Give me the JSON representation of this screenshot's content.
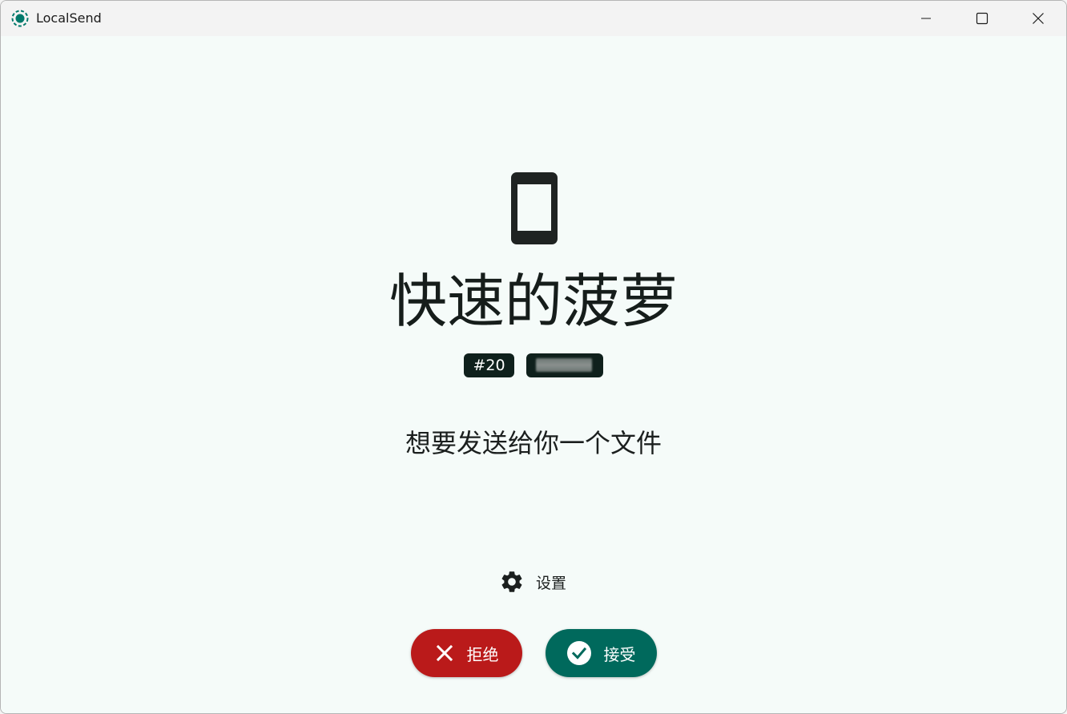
{
  "window": {
    "title": "LocalSend",
    "controls": [
      "minimize",
      "maximize",
      "close"
    ]
  },
  "device": {
    "icon": "phone-icon",
    "name": "快速的菠萝",
    "badges": {
      "port_label": "#20",
      "ip_label": ""
    }
  },
  "request": {
    "message": "想要发送给你一个文件"
  },
  "settings": {
    "label": "设置",
    "icon": "gear-icon"
  },
  "actions": {
    "decline_label": "拒绝",
    "accept_label": "接受"
  },
  "colors": {
    "accent": "#00695c",
    "decline": "#ba1a1a",
    "background": "#f5fbf9",
    "badge": "#0f201c"
  }
}
